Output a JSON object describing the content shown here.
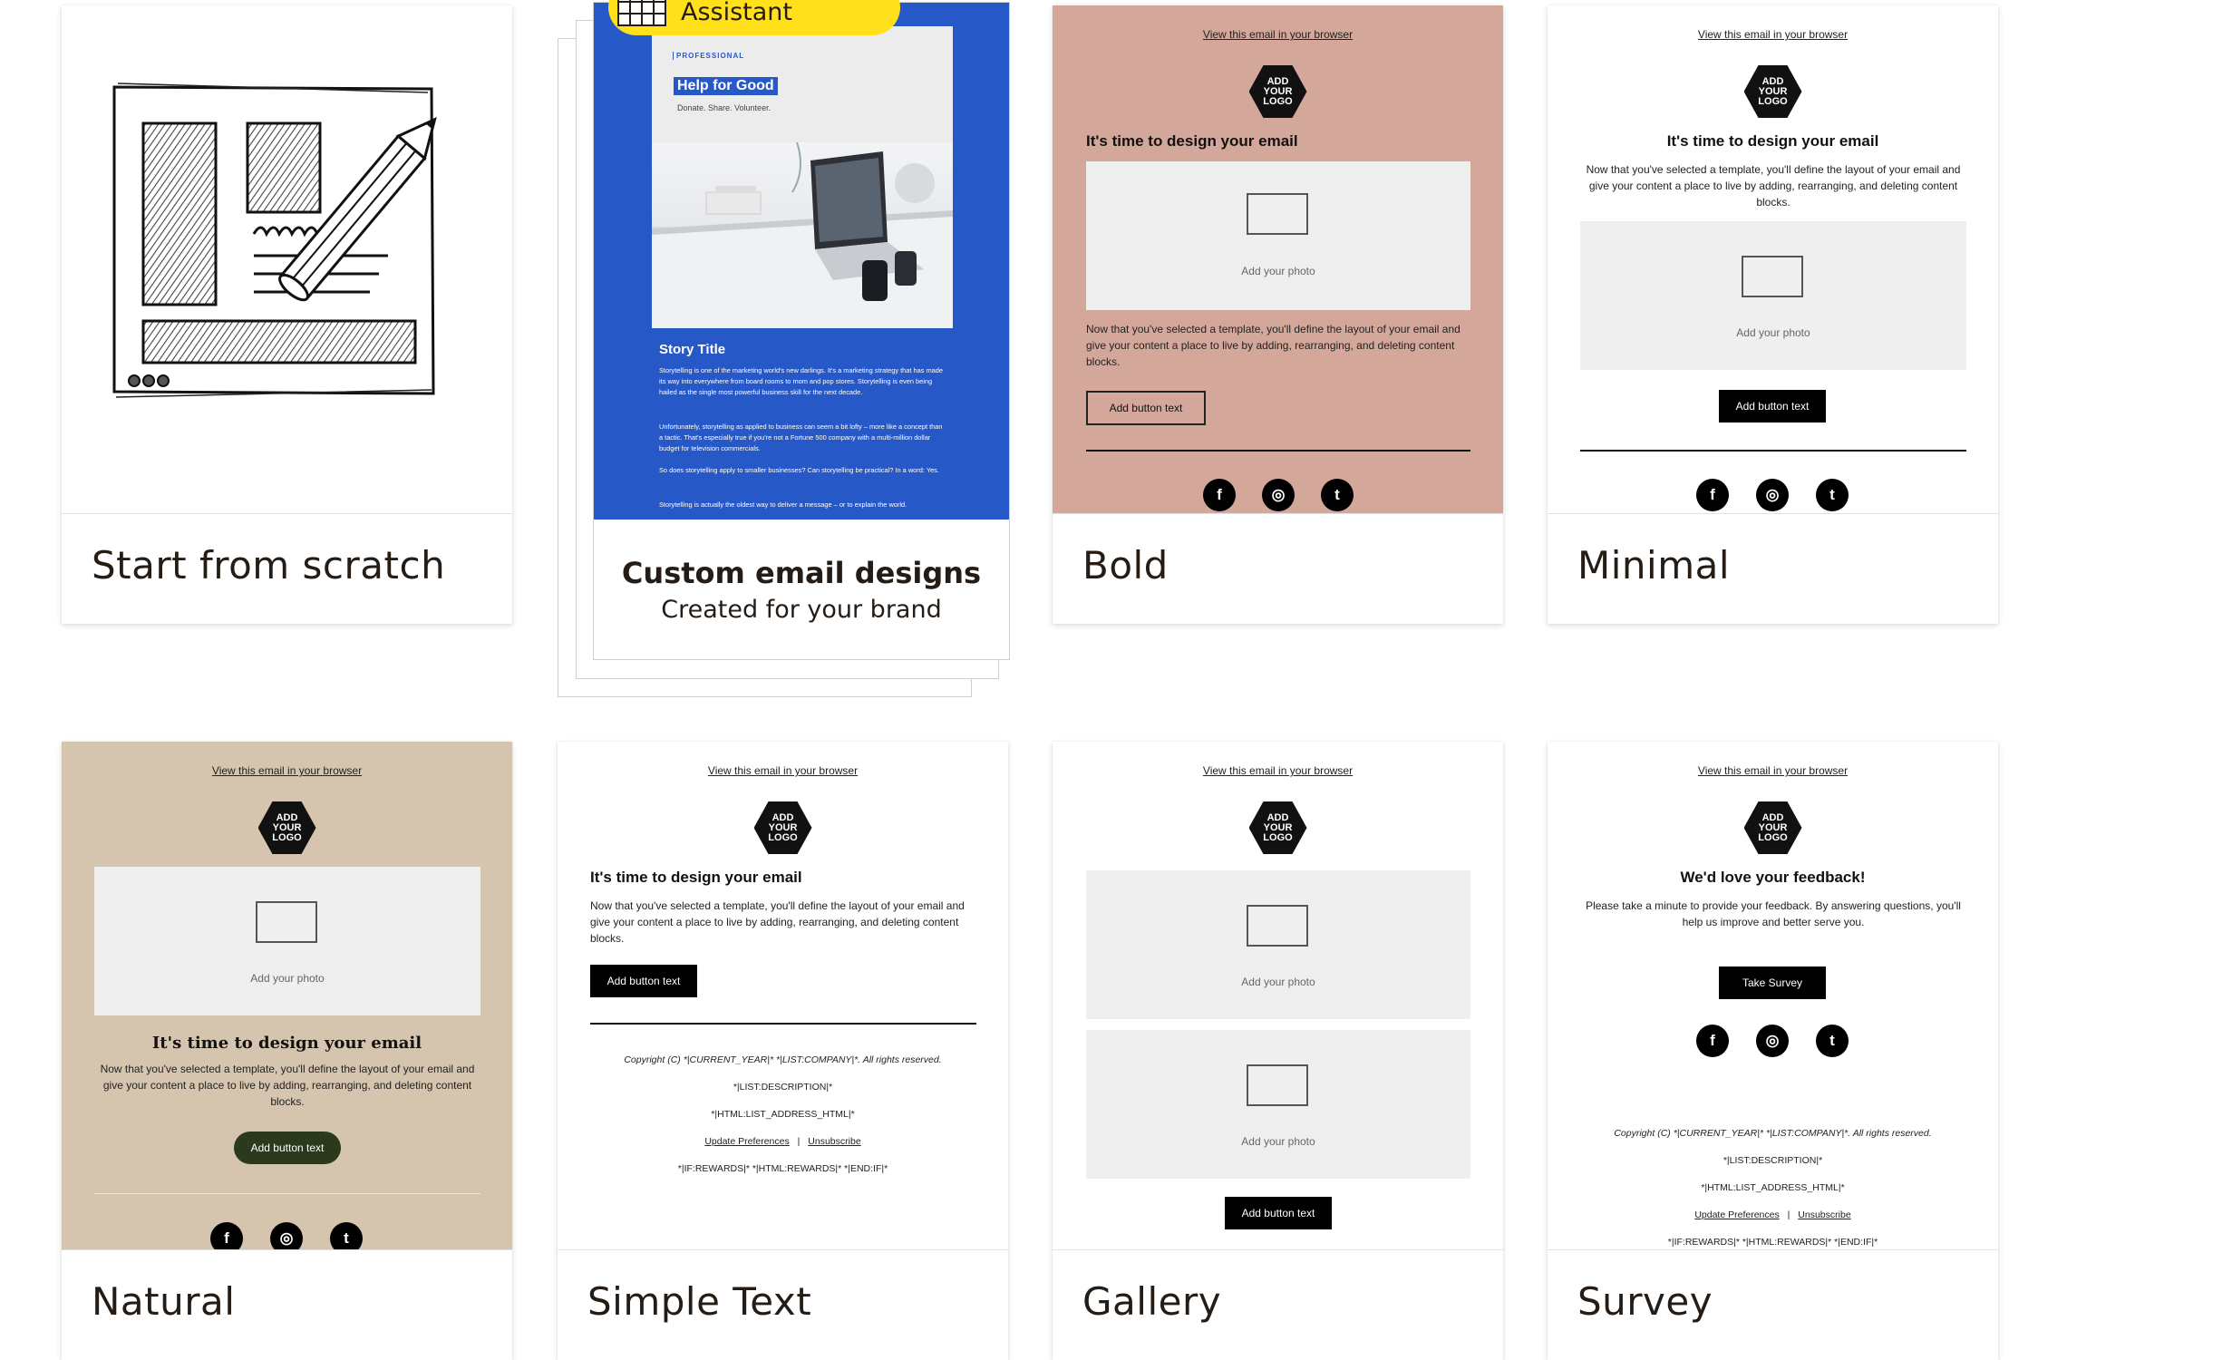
{
  "templates": [
    {
      "caption": "Start from scratch"
    },
    {
      "caption": "Custom email designs",
      "subcaption": "Created for your brand"
    },
    {
      "caption": "Bold"
    },
    {
      "caption": "Minimal"
    },
    {
      "caption": "Natural"
    },
    {
      "caption": "Simple Text"
    },
    {
      "caption": "Gallery"
    },
    {
      "caption": "Survey"
    }
  ],
  "creative_assistant": {
    "label": "Creative Assistant"
  },
  "custom_preview": {
    "eyebrow": "PROFESSIONAL",
    "headline": "Help for Good",
    "tagline": "Donate. Share. Volunteer.",
    "story_title": "Story Title",
    "p1": "Storytelling is one of the marketing world's new darlings. It's a marketing strategy that has made its way into everywhere from board rooms to mom and pop stores. Storytelling is even being hailed as the single most powerful business skill for the next decade.",
    "p2": "Unfortunately, storytelling as applied to business can seem a bit lofty – more like a concept than a tactic. That's especially true if you're not a Fortune 500 company with a multi-million dollar budget for television commercials.",
    "p3": "So does storytelling apply to smaller businesses? Can storytelling be practical? In a word: Yes.",
    "p4": "Storytelling is actually the oldest way to deliver a message – or to explain the world."
  },
  "email": {
    "view_browser": "View this email in your browser",
    "logo": "ADD YOUR LOGO",
    "headline": "It's time to design your email",
    "body": "Now that you've selected a template, you'll define the layout of your email and give your content a place to live by adding, rearranging, and deleting content blocks.",
    "photo_label": "Add your photo",
    "button": "Add button text",
    "copyright": "Copyright (C) *|CURRENT_YEAR|* *|LIST:COMPANY|*. All rights reserved.",
    "list_description": "*|LIST:DESCRIPTION|*",
    "list_address": "*|HTML:LIST_ADDRESS_HTML|*",
    "update_prefs": "Update Preferences",
    "separator": "|",
    "unsubscribe": "Unsubscribe",
    "rewards": "*|IF:REWARDS|* *|HTML:REWARDS|* *|END:IF|*",
    "social": {
      "facebook": "f",
      "instagram": "◎",
      "twitter": "t"
    }
  },
  "survey": {
    "headline": "We'd love your feedback!",
    "body": "Please take a minute to provide your feedback. By answering questions, you'll help us improve and better serve you.",
    "button": "Take Survey"
  },
  "colors": {
    "bold_bg": "#d4a79b",
    "natural_bg": "#d5c4ae",
    "natural_button": "#2b3a1d",
    "custom_blue": "#2758c8",
    "assistant_yellow": "#ffe01b"
  }
}
